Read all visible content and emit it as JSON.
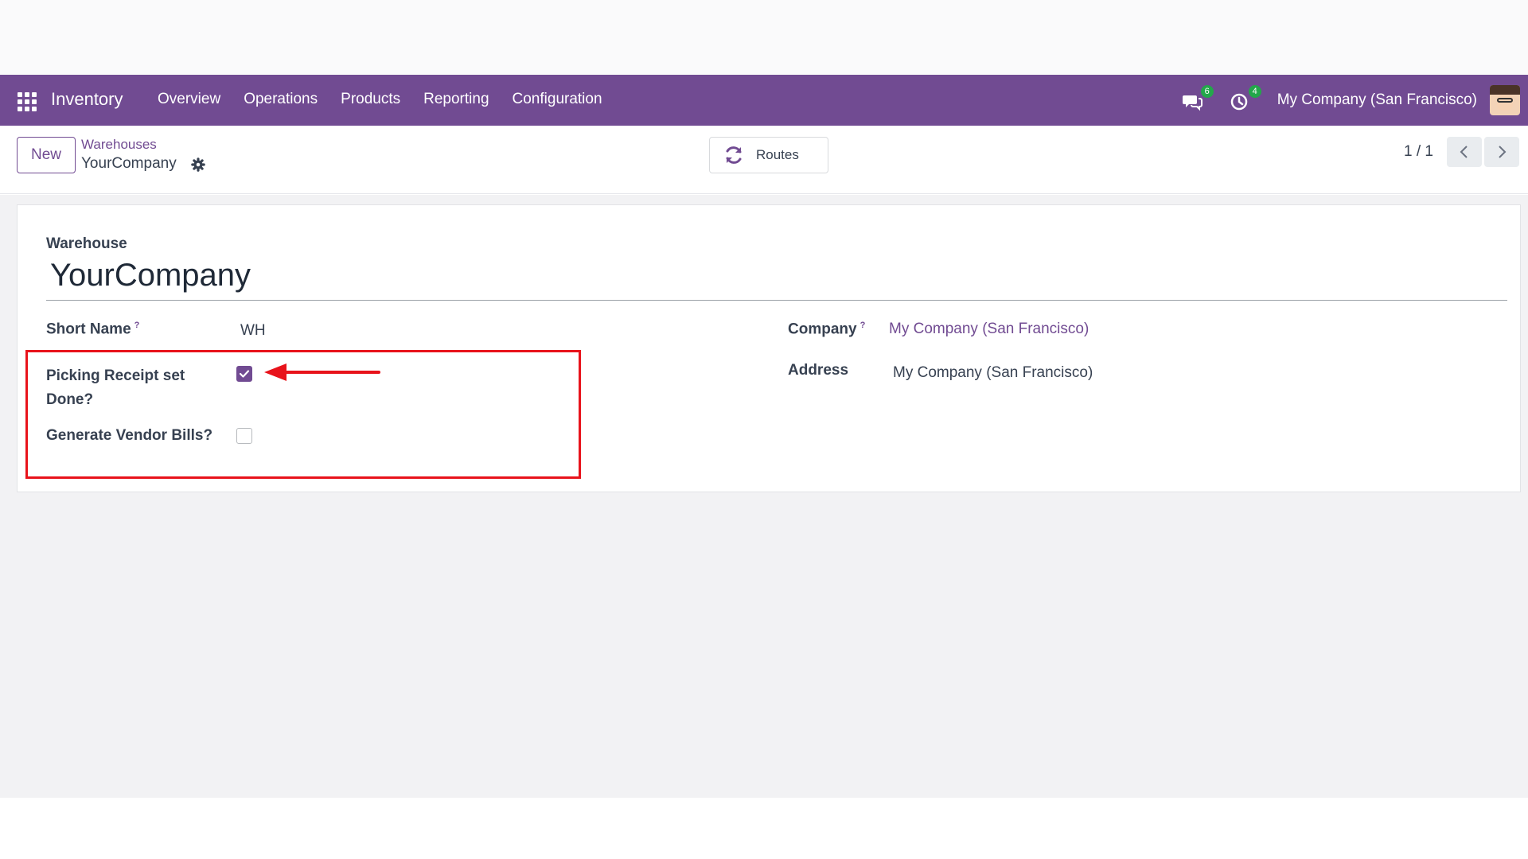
{
  "navbar": {
    "app_name": "Inventory",
    "menu": [
      "Overview",
      "Operations",
      "Products",
      "Reporting",
      "Configuration"
    ],
    "messages_count": "6",
    "activities_count": "4",
    "company": "My Company (San Francisco)",
    "accent_color": "#714B92"
  },
  "control_panel": {
    "new_label": "New",
    "breadcrumb_parent": "Warehouses",
    "breadcrumb_current": "YourCompany",
    "routes_label": "Routes",
    "pager": "1 / 1"
  },
  "form": {
    "warehouse_label": "Warehouse",
    "warehouse_name": "YourCompany",
    "short_name_label": "Short Name",
    "short_name_value": "WH",
    "help_mark": "?",
    "picking_receipt_label": "Picking Receipt set Done?",
    "picking_receipt_checked": true,
    "vendor_bills_label": "Generate Vendor Bills?",
    "vendor_bills_checked": false,
    "company_label": "Company",
    "company_value": "My Company (San Francisco)",
    "address_label": "Address",
    "address_value": "My Company (San Francisco)"
  },
  "annotation": {
    "highlight_color": "#e8131b"
  }
}
